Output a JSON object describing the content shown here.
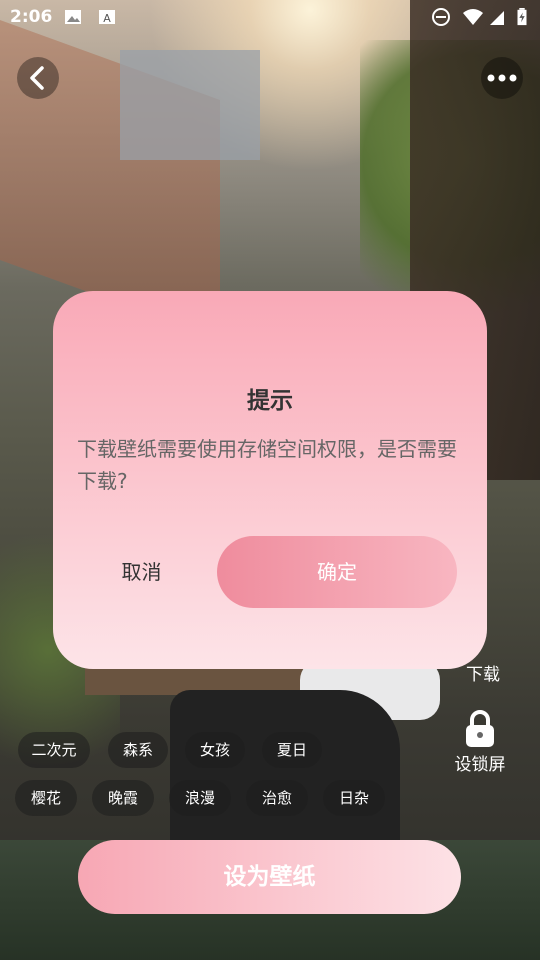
{
  "status_bar": {
    "time": "2:06",
    "icons": [
      "gallery-icon",
      "text-a-icon",
      "do-not-disturb-icon",
      "wifi-icon",
      "signal-icon",
      "battery-charging-icon"
    ]
  },
  "top_bar": {
    "back_icon": "chevron-left-icon",
    "more_icon": "more-dots-icon"
  },
  "side_actions": {
    "download_label": "下载",
    "lockscreen_label": "设锁屏"
  },
  "tags": [
    "二次元",
    "森系",
    "女孩",
    "夏日",
    "樱花",
    "晚霞",
    "浪漫",
    "治愈",
    "日杂"
  ],
  "set_wallpaper_label": "设为壁纸",
  "dialog": {
    "title": "提示",
    "message": "下载壁纸需要使用存储空间权限，是否需要下载?",
    "cancel_label": "取消",
    "confirm_label": "确定"
  },
  "colors": {
    "accent_pink": "#ef8c9d",
    "dialog_top": "#f9a9b7",
    "dialog_bottom": "#fde4e8"
  }
}
